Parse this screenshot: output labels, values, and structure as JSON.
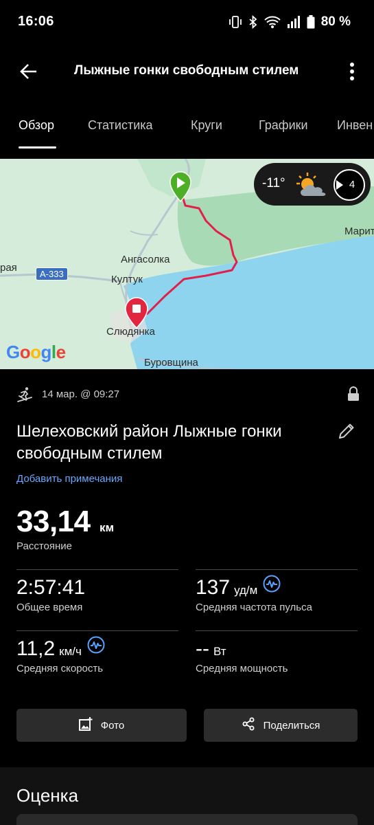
{
  "status_bar": {
    "time": "16:06",
    "battery": "80 %"
  },
  "app_bar": {
    "title": "Лыжные гонки свободным стилем"
  },
  "tabs": [
    {
      "label": "Обзор",
      "active": true
    },
    {
      "label": "Статистика",
      "active": false
    },
    {
      "label": "Круги",
      "active": false
    },
    {
      "label": "Графики",
      "active": false
    },
    {
      "label": "Инвен",
      "active": false
    }
  ],
  "map": {
    "weather": {
      "temperature": "-11°",
      "icon": "partly-cloudy-icon",
      "wind": "4"
    },
    "labels": {
      "angasolka": "Ангасолка",
      "kultuk": "Култук",
      "slyudyanka": "Слюдянка",
      "burovshchina": "Буровщина",
      "marit": "Марит",
      "raya": "рая",
      "road": "A-333"
    },
    "attribution": "Google",
    "colors": {
      "land": "#d4ecd9",
      "forest": "#a8d9b4",
      "water": "#8fd4ee",
      "route": "#e0204a",
      "start": "#4caf26",
      "end": "#e3263f"
    }
  },
  "activity": {
    "date": "14 мар. @ 09:27",
    "title": "Шелеховский район Лыжные гонки свободным стилем",
    "add_note": "Добавить примечания",
    "distance": {
      "value": "33,14",
      "unit": "км",
      "label": "Расстояние"
    },
    "stats": {
      "total_time": {
        "value": "2:57:41",
        "unit": "",
        "label": "Общее время"
      },
      "avg_hr": {
        "value": "137",
        "unit": "уд/м",
        "label": "Средняя частота пульса"
      },
      "avg_speed": {
        "value": "11,2",
        "unit": "км/ч",
        "label": "Средняя скорость"
      },
      "avg_power": {
        "value": "--",
        "unit": "Вт",
        "label": "Средняя мощность"
      }
    }
  },
  "actions": {
    "photo": "Фото",
    "share": "Поделиться"
  },
  "rating": {
    "title": "Оценка"
  },
  "colors": {
    "accent_link": "#6aa9ff",
    "hr_icon": "#5aa0ff",
    "button_bg": "#2c2c2c"
  }
}
